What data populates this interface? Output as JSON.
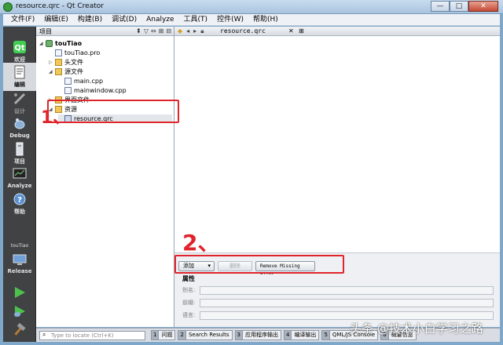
{
  "window": {
    "title": "resource.qrc - Qt Creator",
    "controls": [
      "—",
      "□",
      "✕"
    ]
  },
  "menu": [
    "文件(F)",
    "编辑(E)",
    "构建(B)",
    "调试(D)",
    "Analyze",
    "工具(T)",
    "控件(W)",
    "帮助(H)"
  ],
  "modes": [
    {
      "label": "欢迎",
      "icon": "qt-logo-icon"
    },
    {
      "label": "编辑",
      "icon": "edit-icon"
    },
    {
      "label": "设计",
      "icon": "design-icon"
    },
    {
      "label": "Debug",
      "icon": "debug-icon"
    },
    {
      "label": "项目",
      "icon": "projects-icon"
    },
    {
      "label": "Analyze",
      "icon": "analyze-icon"
    },
    {
      "label": "帮助",
      "icon": "help-icon"
    }
  ],
  "kit": {
    "project": "touTiao",
    "config": "Release"
  },
  "project_panel": {
    "header": "项目",
    "tree": [
      {
        "label": "touTiao",
        "type": "proj",
        "bold": true
      },
      {
        "label": "touTiao.pro",
        "type": "file"
      },
      {
        "label": "头文件",
        "type": "folder"
      },
      {
        "label": "源文件",
        "type": "folder"
      },
      {
        "label": "main.cpp",
        "type": "file"
      },
      {
        "label": "mainwindow.cpp",
        "type": "file"
      },
      {
        "label": "界面文件",
        "type": "folder"
      },
      {
        "label": "资源",
        "type": "folder"
      },
      {
        "label": "resource.qrc",
        "type": "qrc"
      }
    ]
  },
  "editor": {
    "file": "resource.qrc",
    "close": "✕"
  },
  "resource_editor": {
    "add_label": "添加",
    "delete_label": "删除",
    "remove_missing_label": "Remove Missing Files",
    "properties_heading": "属性",
    "fields": [
      "别名:",
      "前缀:",
      "语言:"
    ]
  },
  "statusbar": {
    "locator_placeholder": "Type to locate (Ctrl+K)",
    "panes": [
      {
        "num": "1",
        "name": "问题"
      },
      {
        "num": "2",
        "name": "Search Results"
      },
      {
        "num": "3",
        "name": "应用程序输出"
      },
      {
        "num": "4",
        "name": "编译输出"
      },
      {
        "num": "5",
        "name": "QML/JS Console"
      },
      {
        "num": "6",
        "name": "概要信息"
      }
    ]
  },
  "annotations": {
    "first": "1、",
    "second": "2、"
  },
  "watermark": "头条 @技术小白学习之路",
  "colors": {
    "annotation": "#e0242b",
    "modebar": "#404244"
  }
}
